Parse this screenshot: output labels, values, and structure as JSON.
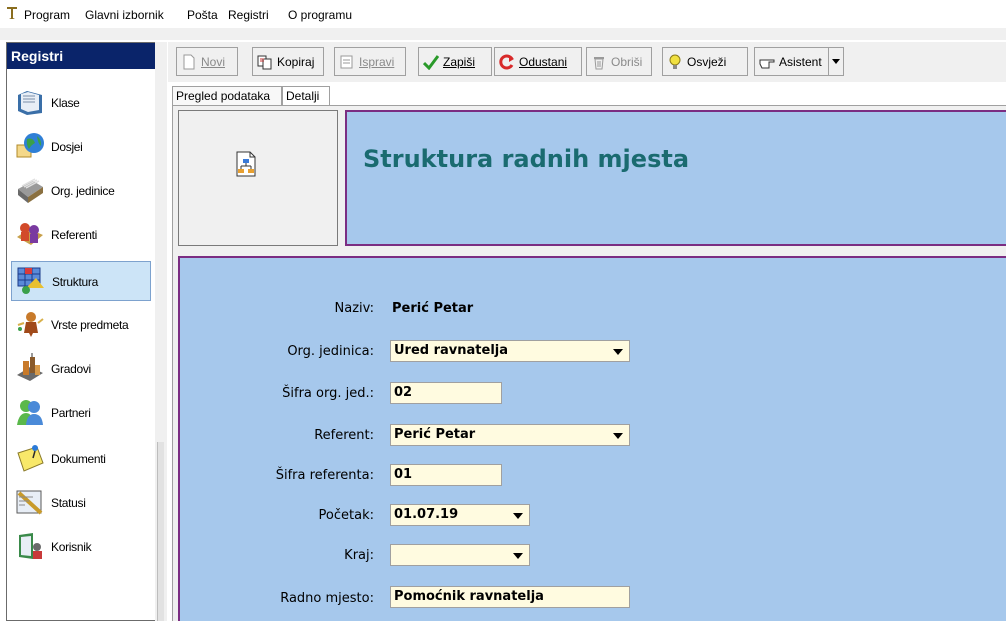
{
  "menu": [
    "Program",
    "Glavni izbornik",
    "Pošta",
    "Registri",
    "O programu"
  ],
  "sidebar": {
    "title": "Registri",
    "items": [
      {
        "label": "Klase",
        "icon": "folder-icon"
      },
      {
        "label": "Dosjei",
        "icon": "globe-files-icon"
      },
      {
        "label": "Org. jedinice",
        "icon": "card-file-icon"
      },
      {
        "label": "Referenti",
        "icon": "people-icon"
      },
      {
        "label": "Struktura",
        "icon": "structure-grid-icon",
        "selected": true
      },
      {
        "label": "Vrste predmeta",
        "icon": "figure-icon"
      },
      {
        "label": "Gradovi",
        "icon": "city-icon"
      },
      {
        "label": "Partneri",
        "icon": "partners-icon"
      },
      {
        "label": "Dokumenti",
        "icon": "sticky-note-icon"
      },
      {
        "label": "Statusi",
        "icon": "ruler-icon"
      },
      {
        "label": "Korisnik",
        "icon": "user-book-icon"
      }
    ]
  },
  "toolbar": {
    "novi": "Novi",
    "kopiraj": "Kopiraj",
    "ispravi": "Ispravi",
    "zapisi": "Zapiši",
    "odustani": "Odustani",
    "obrisi": "Obriši",
    "osvjezi": "Osvježi",
    "asistent": "Asistent"
  },
  "tabs": {
    "pregled": "Pregled podataka",
    "detalji": "Detalji"
  },
  "header": {
    "title": "Struktura radnih mjesta"
  },
  "form": {
    "naziv_label": "Naziv:",
    "naziv_value": "Perić Petar",
    "org_label": "Org. jedinica:",
    "org_value": "Ured ravnatelja",
    "sifra_org_label": "Šifra org. jed.:",
    "sifra_org_value": "02",
    "referent_label": "Referent:",
    "referent_value": "Perić Petar",
    "sifra_ref_label": "Šifra referenta:",
    "sifra_ref_value": "01",
    "pocetak_label": "Početak:",
    "pocetak_value": "01.07.19",
    "kraj_label": "Kraj:",
    "kraj_value": "",
    "radno_label": "Radno mjesto:",
    "radno_value": "Pomoćnik ravnatelja"
  },
  "colors": {
    "header_bg": "#0a246a",
    "panel_bg": "#a6c8ec",
    "panel_border": "#7b2d82",
    "title_text": "#1a6b70",
    "input_bg": "#fffbe0"
  }
}
